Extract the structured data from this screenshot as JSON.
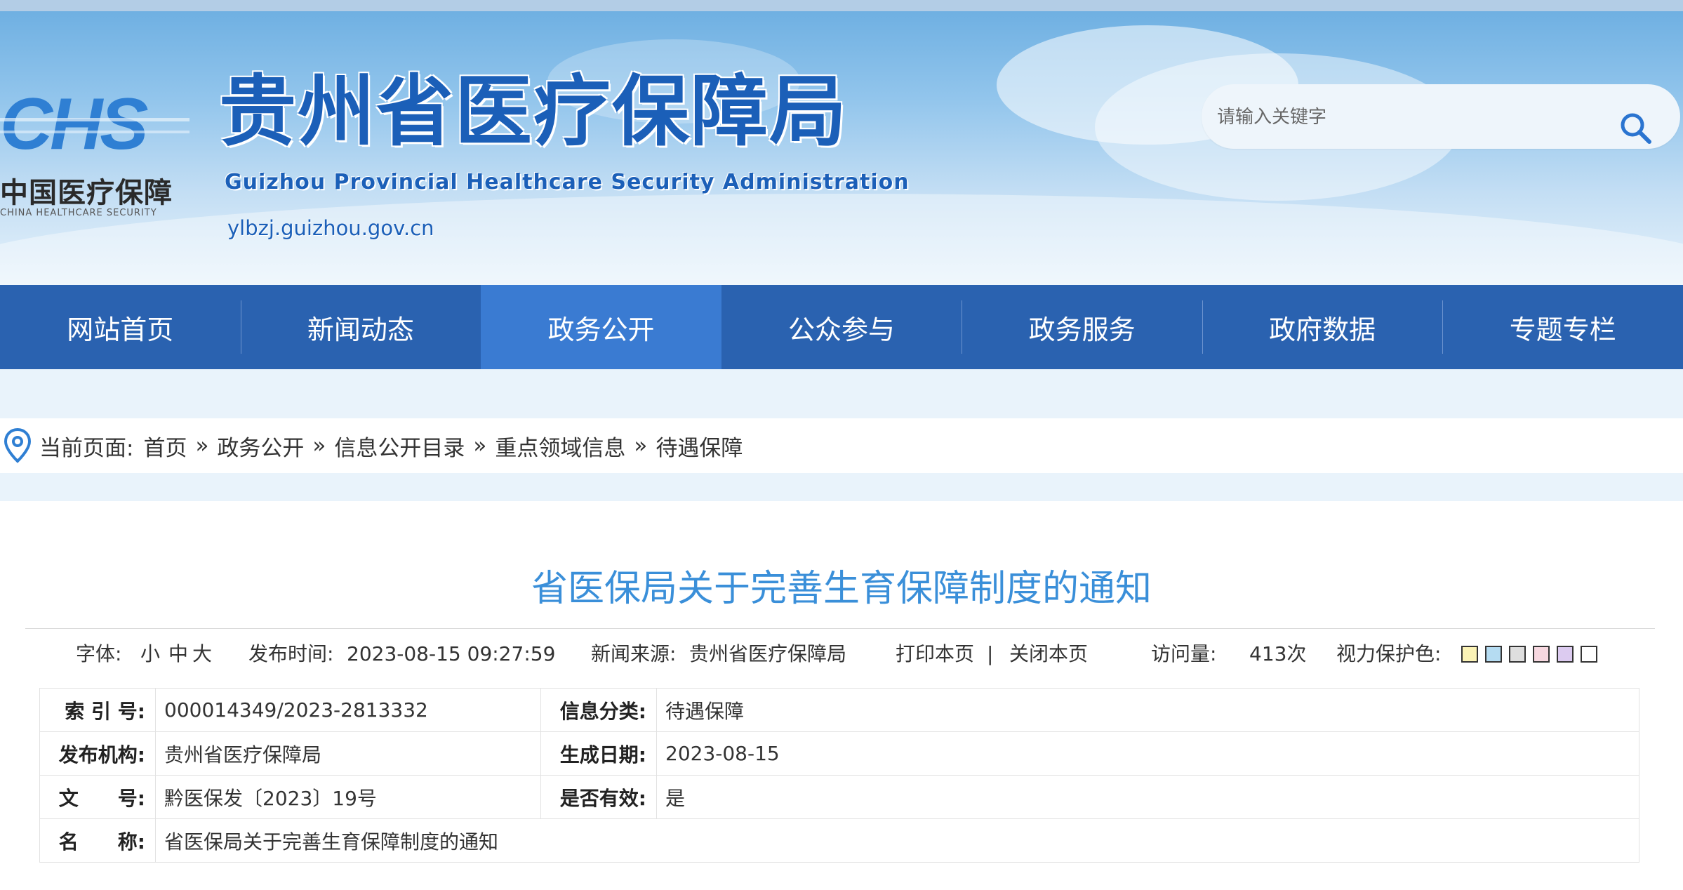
{
  "header": {
    "logo_mark": "CHS",
    "logo_cn": "中国医疗保障",
    "logo_en": "CHINA HEALTHCARE SECURITY",
    "site_title": "贵州省医疗保障局",
    "site_en": "Guizhou Provincial Healthcare Security Administration",
    "site_url": "ylbzj.guizhou.gov.cn",
    "search_placeholder": "请输入关键字",
    "search_icon": "search-icon"
  },
  "nav": {
    "items": [
      {
        "label": "网站首页"
      },
      {
        "label": "新闻动态"
      },
      {
        "label": "政务公开",
        "active": true
      },
      {
        "label": "公众参与"
      },
      {
        "label": "政务服务"
      },
      {
        "label": "政府数据"
      },
      {
        "label": "专题专栏"
      }
    ]
  },
  "breadcrumb": {
    "icon": "location-pin-icon",
    "prefix": "当前页面:",
    "separator": "»",
    "items": [
      "首页",
      "政务公开",
      "信息公开目录",
      "重点领域信息",
      "待遇保障"
    ]
  },
  "article": {
    "title": "省医保局关于完善生育保障制度的通知",
    "meta": {
      "font_label": "字体:",
      "font_small": "小",
      "font_medium": "中",
      "font_large": "大",
      "publish_time_label": "发布时间:",
      "publish_time": "2023-08-15 09:27:59",
      "source_label": "新闻来源:",
      "source": "贵州省医疗保障局",
      "print": "打印本页",
      "divider": "|",
      "close": "关闭本页",
      "visits_label": "访问量:",
      "visits": "413次",
      "eye_care_label": "视力保护色:",
      "eye_care_colors": [
        "#fbf3b6",
        "#b5dcf2",
        "#dedede",
        "#f7d8e0",
        "#dccbf0",
        "#ffffff"
      ]
    },
    "info": {
      "index_label": "索 引 号:",
      "index": "000014349/2023-2813332",
      "category_label": "信息分类:",
      "category": "待遇保障",
      "org_label": "发布机构:",
      "org": "贵州省医疗保障局",
      "date_label": "生成日期:",
      "date": "2023-08-15",
      "doc_no_label": "文　　号:",
      "doc_no": "黔医保发〔2023〕19号",
      "valid_label": "是否有效:",
      "valid": "是",
      "name_label": "名　　称:",
      "name": "省医保局关于完善生育保障制度的通知"
    }
  }
}
